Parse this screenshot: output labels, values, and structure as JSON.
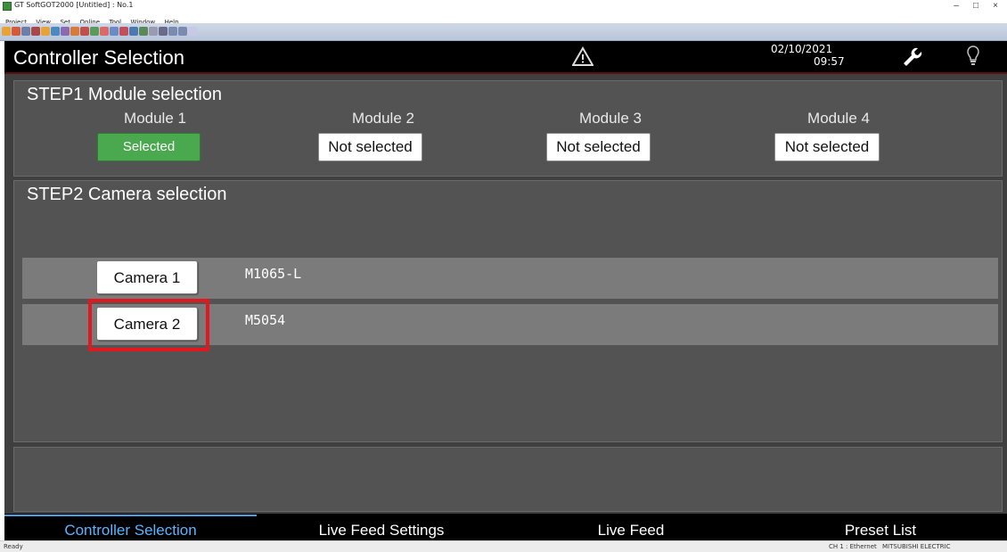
{
  "window": {
    "title": "GT SoftGOT2000 [Untitled] : No.1",
    "controls": [
      "–",
      "□",
      "×"
    ]
  },
  "menu": [
    "Project",
    "View",
    "Set",
    "Online",
    "Tool",
    "Window",
    "Help"
  ],
  "header": {
    "screen_title": "Controller Selection",
    "date": "02/10/2021",
    "time": "09:57"
  },
  "step1": {
    "title": "STEP1 Module selection",
    "modules": [
      {
        "label": "Module 1",
        "status": "Selected"
      },
      {
        "label": "Module 2",
        "status": "Not selected"
      },
      {
        "label": "Module 3",
        "status": "Not selected"
      },
      {
        "label": "Module 4",
        "status": "Not selected"
      }
    ]
  },
  "step2": {
    "title": "STEP2 Camera selection",
    "cameras": [
      {
        "label": "Camera 1",
        "model": "M1065-L"
      },
      {
        "label": "Camera 2",
        "model": "M5054"
      }
    ]
  },
  "tabs": [
    {
      "label": "Controller Selection",
      "active": true
    },
    {
      "label": "Live Feed Settings",
      "active": false
    },
    {
      "label": "Live Feed",
      "active": false
    },
    {
      "label": "Preset List",
      "active": false
    }
  ],
  "status": {
    "left": "Ready",
    "channel": "CH 1 : Ethernet",
    "vendor": "MITSUBISHI ELECTRIC"
  },
  "colors": {
    "selected": "#4aa84e",
    "highlight": "#e0191f",
    "active_tab": "#5ab4ff"
  }
}
